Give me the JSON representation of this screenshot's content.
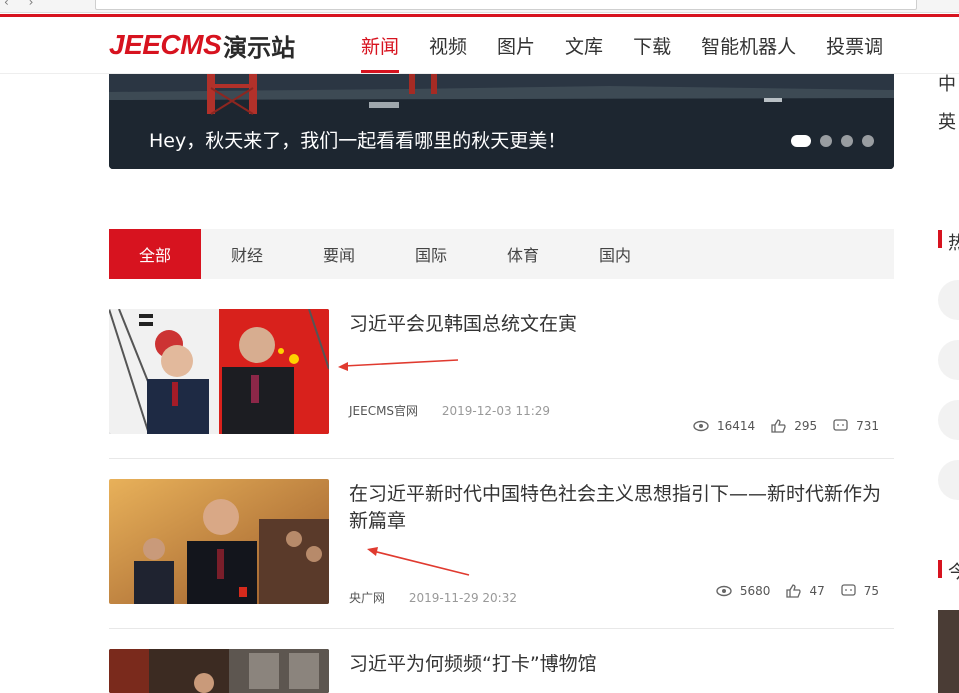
{
  "header": {
    "logo_brand": "JEECMS",
    "logo_suffix": "演示站",
    "nav": [
      {
        "label": "新闻",
        "active": true
      },
      {
        "label": "视频",
        "active": false
      },
      {
        "label": "图片",
        "active": false
      },
      {
        "label": "文库",
        "active": false
      },
      {
        "label": "下载",
        "active": false
      },
      {
        "label": "智能机器人",
        "active": false
      },
      {
        "label": "投票调",
        "active": false
      }
    ]
  },
  "banner": {
    "caption": "Hey，秋天来了，我们一起看看哪里的秋天更美！",
    "slide_count": 4,
    "active_slide": 1
  },
  "tabs": [
    {
      "label": "全部",
      "active": true
    },
    {
      "label": "财经",
      "active": false
    },
    {
      "label": "要闻",
      "active": false
    },
    {
      "label": "国际",
      "active": false
    },
    {
      "label": "体育",
      "active": false
    },
    {
      "label": "国内",
      "active": false
    }
  ],
  "articles": [
    {
      "title": "习近平会见韩国总统文在寅",
      "source": "JEECMS官网",
      "date": "2019-12-03 11:29",
      "views": "16414",
      "likes": "295",
      "comments": "731"
    },
    {
      "title": "在习近平新时代中国特色社会主义思想指引下——新时代新作为新篇章",
      "source": "央广网",
      "date": "2019-11-29 20:32",
      "views": "5680",
      "likes": "47",
      "comments": "75"
    },
    {
      "title": "习近平为何频频“打卡”博物馆"
    }
  ],
  "sidebar": {
    "top_text_1": "中",
    "top_text_2": "英",
    "heading_1": "热",
    "heading_2": "今"
  },
  "colors": {
    "accent": "#d7131f",
    "tab_bg": "#f4f4f4"
  },
  "icons": [
    "eye-icon",
    "thumbs-up-icon",
    "comment-icon"
  ]
}
